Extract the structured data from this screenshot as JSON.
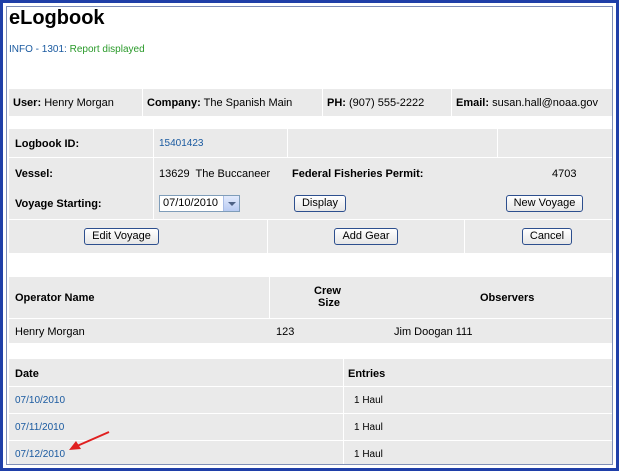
{
  "app": {
    "title": "eLogbook"
  },
  "message": {
    "code": "INFO - 1301:",
    "text": "Report displayed"
  },
  "user_bar": {
    "user_label": "User:",
    "user_value": "Henry Morgan",
    "company_label": "Company:",
    "company_value": "The Spanish Main",
    "phone_label": "PH:",
    "phone_value": "(907) 555-2222",
    "email_label": "Email:",
    "email_value": "susan.hall@noaa.gov"
  },
  "logbook": {
    "id_label": "Logbook ID:",
    "id_value": "15401423",
    "vessel_label": "Vessel:",
    "vessel_number": "13629",
    "vessel_name": "The Buccaneer",
    "permit_label": "Federal Fisheries Permit:",
    "permit_value": "4703",
    "voyage_label": "Voyage Starting:",
    "voyage_selected": "07/10/2010",
    "display_button": "Display",
    "new_voyage_button": "New Voyage"
  },
  "actions": {
    "edit_voyage": "Edit Voyage",
    "add_gear": "Add Gear",
    "cancel": "Cancel"
  },
  "crew": {
    "headers": {
      "operator": "Operator Name",
      "crew_line1": "Crew",
      "crew_line2": "Size",
      "observers": "Observers"
    },
    "row": {
      "operator": "Henry Morgan",
      "crew_size": "123",
      "observers": "Jim Doogan 111"
    }
  },
  "entries": {
    "headers": {
      "date": "Date",
      "entries": "Entries"
    },
    "rows": [
      {
        "date": "07/10/2010",
        "entries": "1 Haul"
      },
      {
        "date": "07/11/2010",
        "entries": "1 Haul"
      },
      {
        "date": "07/12/2010",
        "entries": "1 Haul"
      }
    ]
  },
  "colors": {
    "frame": "#1f3fa8",
    "link": "#1a5aa0",
    "success": "#2a9a2a",
    "annotation_arrow": "#e02020",
    "band": "#eaeaea"
  }
}
